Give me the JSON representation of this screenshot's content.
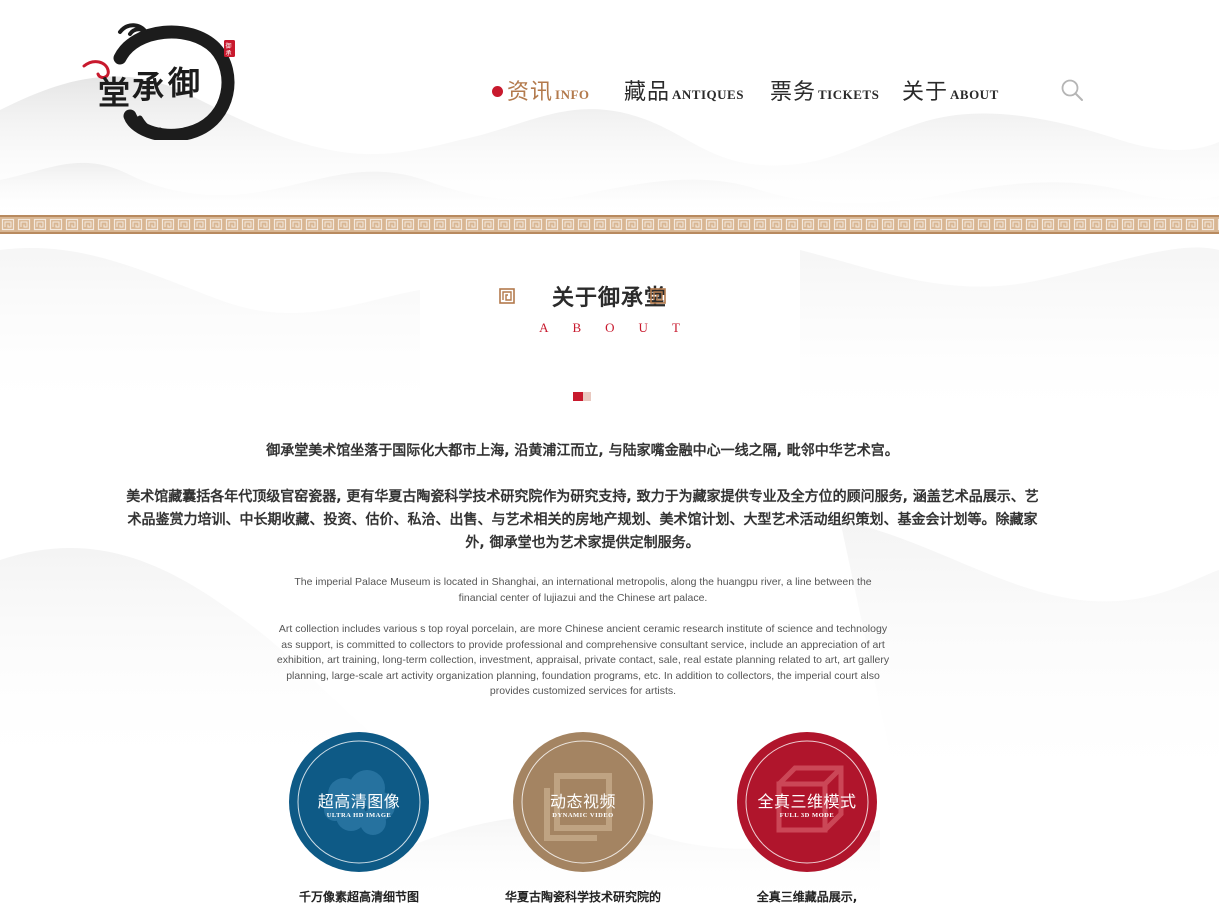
{
  "brand": {
    "logo_text": "御承堂",
    "seal_text": "御承"
  },
  "nav": {
    "items": [
      {
        "zh": "资讯",
        "en": "INFO",
        "active": true
      },
      {
        "zh": "藏品",
        "en": "ANTIQUES",
        "active": false
      },
      {
        "zh": "票务",
        "en": "TICKETS",
        "active": false
      },
      {
        "zh": "关于",
        "en": "ABOUT",
        "active": false
      }
    ],
    "search_icon": "search-icon"
  },
  "about": {
    "title": "关于御承堂",
    "subtitle": "ABOUT",
    "zh_paragraphs": [
      "御承堂美术馆坐落于国际化大都市上海, 沿黄浦江而立, 与陆家嘴金融中心一线之隔, 毗邻中华艺术宫。",
      "美术馆藏囊括各年代顶级官窑瓷器, 更有华夏古陶瓷科学技术研究院作为研究支持, 致力于为藏家提供专业及全方位的顾问服务, 涵盖艺术品展示、艺术品鉴赏力培训、中长期收藏、投资、估价、私洽、出售、与艺术相关的房地产规划、美术馆计划、大型艺术活动组织策划、基金会计划等。除藏家外, 御承堂也为艺术家提供定制服务。"
    ],
    "en_paragraphs": [
      "The imperial Palace Museum is located in Shanghai, an international metropolis, along the huangpu river, a line between the financial center of lujiazui and the Chinese art palace.",
      "Art collection includes various s top royal porcelain, are more Chinese ancient ceramic research institute of science and technology as support, is committed to collectors to provide professional and comprehensive consultant service, include an appreciation of art exhibition, art training, long-term collection, investment, appraisal, private contact, sale, real estate planning related to art, art gallery planning, large-scale art activity organization planning, foundation programs, etc. In addition to collectors, the imperial court also provides customized services for artists."
    ]
  },
  "features": [
    {
      "title": "超高清图像",
      "subtitle": "ULTRA HD IMAGE",
      "caption": "千万像素超高清细节图",
      "color": "#0e5a86"
    },
    {
      "title": "动态视频",
      "subtitle": "DYNAMIC VIDEO",
      "caption": "华夏古陶瓷科学技术研究院的",
      "color": "#a48462"
    },
    {
      "title": "全真三维模式",
      "subtitle": "FULL 3D MODE",
      "caption": "全真三维藏品展示,",
      "color": "#b0152c"
    }
  ],
  "colors": {
    "accent_red": "#c8192d",
    "accent_gold": "#b37a4c",
    "band_brown": "#c79a6e"
  }
}
